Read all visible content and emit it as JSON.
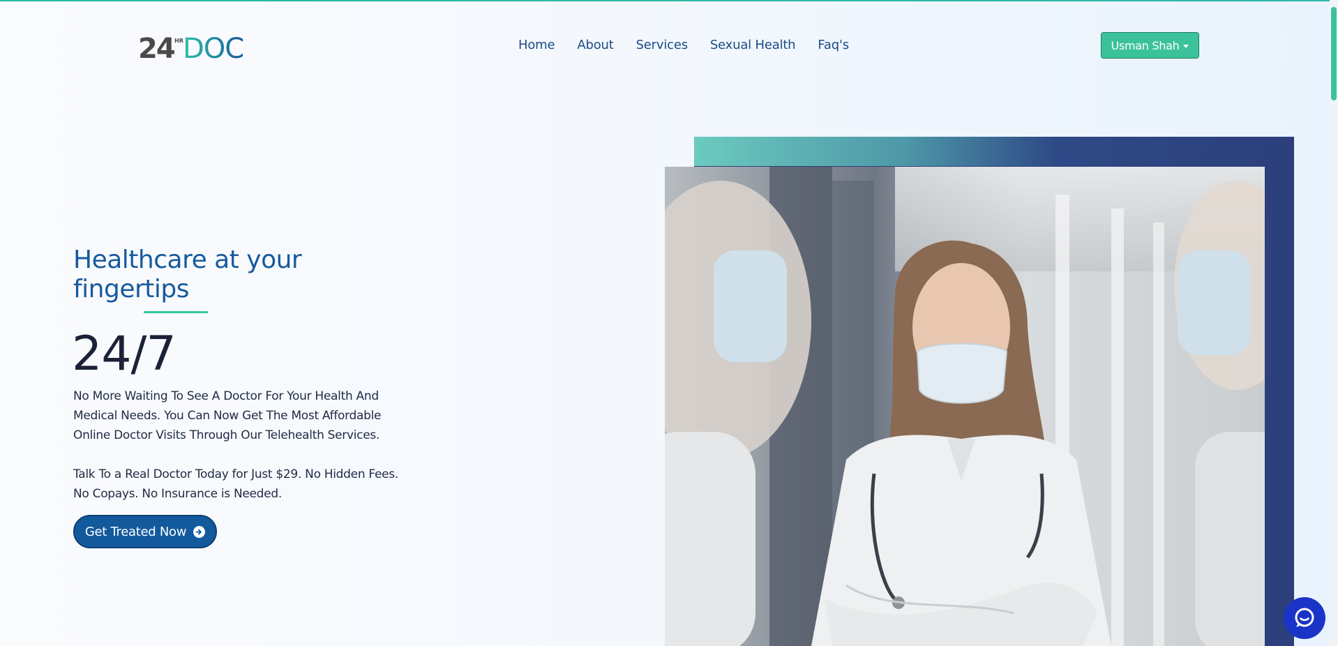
{
  "brand": {
    "logo_text_main": "24",
    "logo_text_sup": "HR",
    "logo_text_doc": "DOC"
  },
  "nav": {
    "items": [
      {
        "label": "Home"
      },
      {
        "label": "About"
      },
      {
        "label": "Services"
      },
      {
        "label": "Sexual Health"
      },
      {
        "label": "Faq's"
      }
    ]
  },
  "user": {
    "name": "Usman Shah"
  },
  "hero": {
    "title_line1": "Healthcare at your",
    "title_line2": "fingertips",
    "big_text": "24/7",
    "paragraph1_line1": "No More Waiting To See A Doctor For Your Health And",
    "paragraph1_line2": "Medical Needs. You Can Now Get The Most Affordable",
    "paragraph1_line3": "Online Doctor Visits Through Our Telehealth Services.",
    "paragraph2_line1": "Talk To a Real Doctor Today for Just $29. No Hidden Fees.",
    "paragraph2_line2": "No Copays. No Insurance is Needed.",
    "cta_label": "Get Treated Now"
  },
  "colors": {
    "accent": "#3cc29a",
    "brand_blue": "#135a9d",
    "nav_text": "#1c4a86",
    "chat": "#1a34c7"
  },
  "icons": {
    "cta": "arrow-right-circle-icon",
    "chat": "chat-bubble-icon",
    "user_menu": "caret-down-icon"
  }
}
